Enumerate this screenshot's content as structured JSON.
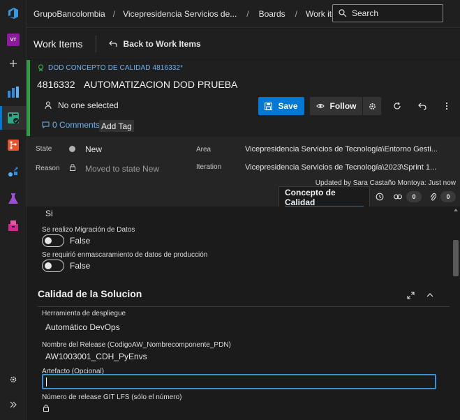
{
  "breadcrumb": {
    "org": "GrupoBancolombia",
    "project": "Vicepresidencia Servicios de...",
    "boards": "Boards",
    "work_items": "Work items"
  },
  "search": {
    "placeholder": "Search"
  },
  "rail": {
    "avatar_initials": "VT",
    "items": [
      "azure-devops-logo",
      "project-avatar",
      "add-icon",
      "overview-icon",
      "boards-icon",
      "repos-icon",
      "pipelines-icon",
      "test-plans-icon",
      "artifacts-icon",
      "settings-icon",
      "expand-icon"
    ]
  },
  "header": {
    "title": "Work Items",
    "back_label": "Back to Work Items"
  },
  "work_item": {
    "type_label": "DOD CONCEPTO DE CALIDAD 4816332*",
    "id": "4816332",
    "title": "AUTOMATIZACION DOD PRUEBA",
    "assignee": "No one selected",
    "comments": "0 Comments",
    "add_tag": "Add Tag",
    "save_label": "Save",
    "follow_label": "Follow"
  },
  "fields": {
    "state_label": "State",
    "state_value": "New",
    "reason_label": "Reason",
    "reason_value": "Moved to state New",
    "area_label": "Area",
    "area_value": "Vicepresidencia Servicios de Tecnología\\Entorno Gesti...",
    "iteration_label": "Iteration",
    "iteration_value": "Vicepresidencia Servicios de Tecnología\\2023\\Sprint 1...",
    "updated_by": "Updated by Sara Castaño Montoya: Just now"
  },
  "tabs": {
    "main": "Concepto de Calidad",
    "links_count": "0",
    "attachments_count": "0"
  },
  "content": {
    "top_value": "Si",
    "migration_label": "Se realizo Migración de Datos",
    "migration_value": "False",
    "masking_label": "Se requirió enmascaramiento de datos de producción",
    "masking_value": "False",
    "section_title": "Calidad de la Solucion",
    "tool_label": "Herramienta de despliegue",
    "tool_value": "Automático DevOps",
    "release_label": "Nombre del Release (CodigoAW_Nombrecomponente_PDN)",
    "release_value": "AW1003001_CDH_PyEnvs",
    "artifact_label": "Artefacto (Opcional)",
    "artifact_value": "",
    "git_label": "Número de release GIT LFS (sólo el número)"
  },
  "colors": {
    "accent": "#0078d4",
    "type_bar": "#339947",
    "link": "#6db3f2"
  }
}
